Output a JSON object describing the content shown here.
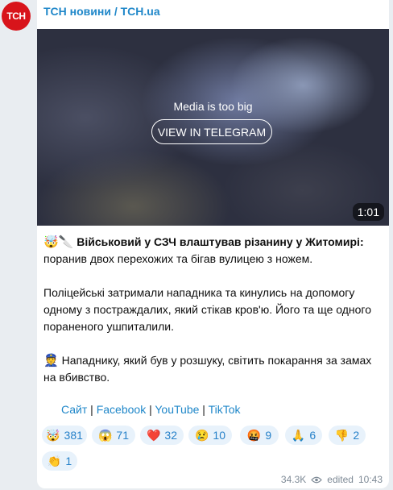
{
  "channel": {
    "avatar_text": "TCH",
    "name": "ТСН новини / TCH.ua"
  },
  "media": {
    "overlay_text": "Media is too big",
    "button_label": "VIEW IN TELEGRAM",
    "duration": "1:01"
  },
  "post": {
    "headline_emoji": "🤯🔪",
    "headline": "Військовий у СЗЧ влаштував різанину у Житомирі:",
    "line1": "поранив двох перехожих та бігав вулицею з ножем.",
    "para2": "Поліцейські затримали нападника та кинулись на допомогу одному з постраждалих, який стікав кров'ю. Його та ще одного пораненого ушпиталили.",
    "para3_emoji": "👮",
    "para3": "Нападнику, який був у розшуку, світить покарання за замах на вбивство."
  },
  "links": [
    {
      "label": "Сайт"
    },
    {
      "label": "Facebook"
    },
    {
      "label": "YouTube"
    },
    {
      "label": "TikTok"
    }
  ],
  "reactions": [
    {
      "emoji": "🤯",
      "count": "381"
    },
    {
      "emoji": "😱",
      "count": "71"
    },
    {
      "emoji": "❤️",
      "count": "32"
    },
    {
      "emoji": "😢",
      "count": "10"
    },
    {
      "emoji": "🤬",
      "count": "9"
    },
    {
      "emoji": "🙏",
      "count": "6"
    },
    {
      "emoji": "👎",
      "count": "2"
    },
    {
      "emoji": "👏",
      "count": "1"
    }
  ],
  "footer": {
    "views": "34.3K",
    "edited": "edited",
    "time": "10:43"
  }
}
